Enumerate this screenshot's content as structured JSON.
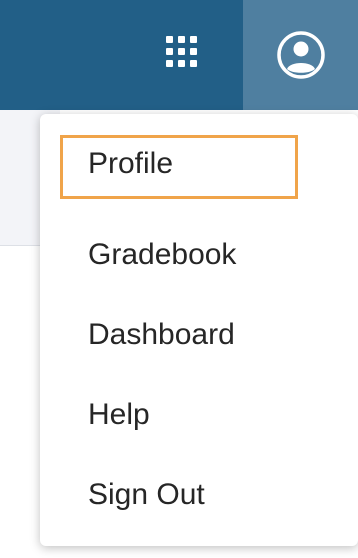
{
  "header": {
    "apps_icon": "apps-grid-icon",
    "account_icon": "user-circle-icon",
    "bg_color": "#225f87",
    "account_bg_color": "#4f7fa0"
  },
  "menu": {
    "items": [
      {
        "label": "Profile",
        "focused": true
      },
      {
        "label": "Gradebook"
      },
      {
        "label": "Dashboard"
      },
      {
        "label": "Help"
      },
      {
        "label": "Sign Out"
      }
    ],
    "focus_color": "#f0a44a"
  }
}
